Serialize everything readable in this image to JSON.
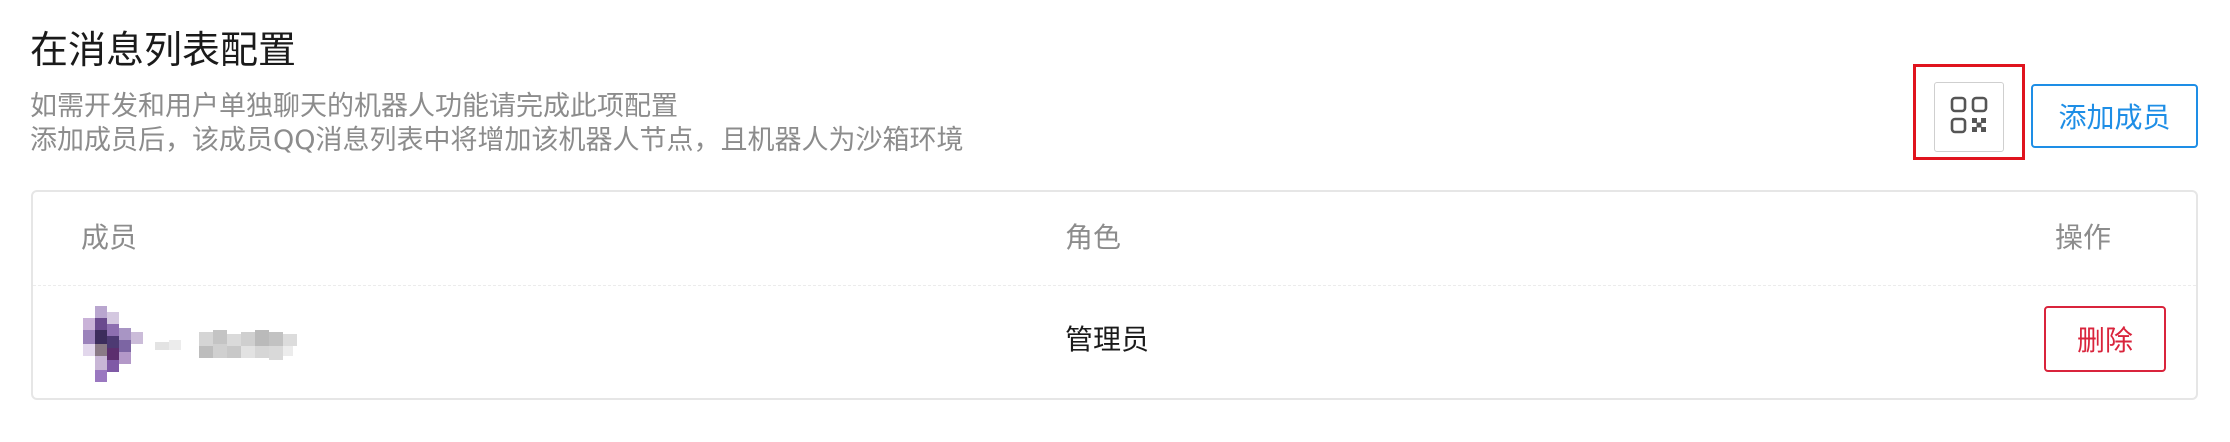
{
  "section": {
    "title": "在消息列表配置",
    "description": [
      "如需开发和用户单独聊天的机器人功能请完成此项配置",
      "添加成员后，该成员QQ消息列表中将增加该机器人节点，且机器人为沙箱环境"
    ]
  },
  "toolbar": {
    "qr_icon": "qr-code-icon",
    "add_member_label": "添加成员"
  },
  "table": {
    "columns": [
      "成员",
      "角色",
      "操作"
    ],
    "rows": [
      {
        "avatar": "avatar",
        "member": "",
        "role": "管理员",
        "action_label": "删除"
      }
    ]
  },
  "colors": {
    "accent": "#1e8ee6",
    "danger": "#d9243c",
    "highlight": "#e0141e",
    "muted_text": "#8c8c8c",
    "border": "#e6e6e6"
  }
}
